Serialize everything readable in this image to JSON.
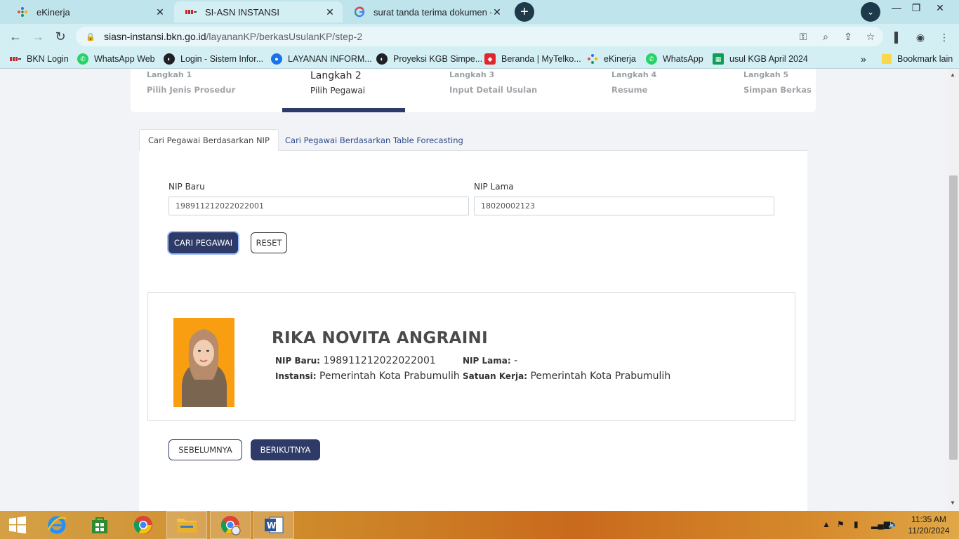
{
  "browser": {
    "tabs": [
      {
        "title": "eKinerja",
        "active": false
      },
      {
        "title": "SI-ASN INSTANSI",
        "active": true
      },
      {
        "title": "surat tanda terima dokumen - Pe",
        "active": false
      }
    ],
    "url_host": "siasn-instansi.bkn.go.id",
    "url_path": "/layananKP/berkasUsulanKP/step-2",
    "bookmarks": [
      "BKN Login",
      "WhatsApp Web",
      "Login - Sistem Infor...",
      "LAYANAN INFORM...",
      "Proyeksi KGB Simpe...",
      "Beranda | MyTelko...",
      "eKinerja",
      "WhatsApp",
      "usul KGB April 2024"
    ],
    "other_bookmarks": "Bookmark lain"
  },
  "stepper": {
    "steps": [
      {
        "title": "Langkah 1",
        "desc": "Pilih Jenis Prosedur"
      },
      {
        "title": "Langkah 2",
        "desc": "Pilih Pegawai"
      },
      {
        "title": "Langkah 3",
        "desc": "Input Detail Usulan"
      },
      {
        "title": "Langkah 4",
        "desc": "Resume"
      },
      {
        "title": "Langkah 5",
        "desc": "Simpan Berkas"
      }
    ]
  },
  "search_tabs": {
    "by_nip": "Cari Pegawai Berdasarkan NIP",
    "by_forecast": "Cari Pegawai Berdasarkan Table Forecasting"
  },
  "form": {
    "nip_baru_label": "NIP Baru",
    "nip_baru_value": "198911212022022001",
    "nip_lama_label": "NIP Lama",
    "nip_lama_value": "18020002123",
    "search_button": "CARI PEGAWAI",
    "reset_button": "RESET"
  },
  "employee": {
    "name": "RIKA NOVITA ANGRAINI",
    "nip_baru_label": "NIP Baru:",
    "nip_baru": "198911212022022001",
    "nip_lama_label": "NIP Lama:",
    "nip_lama": "-",
    "instansi_label": "Instansi:",
    "instansi": "Pemerintah Kota Prabumulih",
    "satuan_kerja_label": "Satuan Kerja:",
    "satuan_kerja": "Pemerintah Kota Prabumulih"
  },
  "nav": {
    "prev": "SEBELUMNYA",
    "next": "BERIKUTNYA"
  },
  "taskbar": {
    "time": "11:35 AM",
    "date": "11/20/2024"
  },
  "colors": {
    "primary": "#2e3a67",
    "tab_strip": "#bfe4ec",
    "photo_bg": "#f89e10"
  }
}
